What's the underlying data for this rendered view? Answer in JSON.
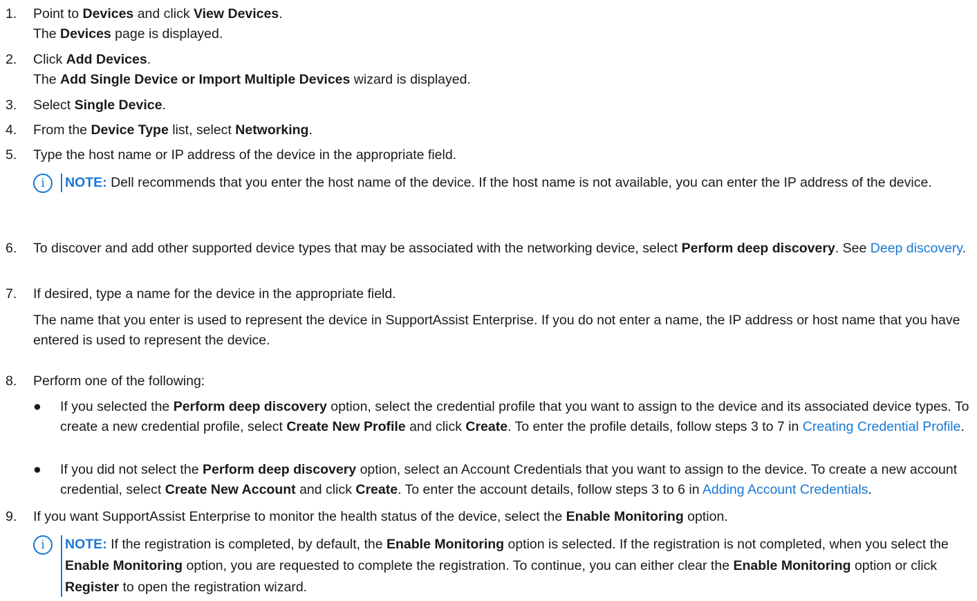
{
  "steps": [
    {
      "num": "1.",
      "l1a": "Point to ",
      "l1b": "Devices",
      "l1c": " and click ",
      "l1d": "View Devices",
      "l1e": ".",
      "l2a": "The ",
      "l2b": "Devices",
      "l2c": " page is displayed."
    },
    {
      "num": "2.",
      "l1a": "Click ",
      "l1b": "Add Devices",
      "l1c": ".",
      "l2a": "The ",
      "l2b": "Add Single Device or Import Multiple Devices",
      "l2c": " wizard is displayed."
    },
    {
      "num": "3.",
      "l1a": "Select ",
      "l1b": "Single Device",
      "l1c": "."
    },
    {
      "num": "4.",
      "l1a": "From the ",
      "l1b": "Device Type",
      "l1c": " list, select ",
      "l1d": "Networking",
      "l1e": "."
    },
    {
      "num": "5.",
      "l1a": "Type the host name or IP address of the device in the appropriate field."
    },
    {
      "num": "6.",
      "l1a": "To discover and add other supported device types that may be associated with the networking device, select ",
      "l1b": "Perform deep discovery",
      "l1c": ". See ",
      "link": "Deep discovery",
      "l1d": "."
    },
    {
      "num": "7.",
      "l1a": "If desired, type a name for the device in the appropriate field.",
      "para": "The name that you enter is used to represent the device in SupportAssist Enterprise. If you do not enter a name, the IP address or host name that you have entered is used to represent the device."
    },
    {
      "num": "8.",
      "l1a": "Perform one of the following:"
    },
    {
      "num": "9.",
      "l1a": "If you want SupportAssist Enterprise to monitor the health status of the device, select the ",
      "l1b": "Enable Monitoring",
      "l1c": " option."
    }
  ],
  "note1": {
    "icon": "info-icon",
    "label": "NOTE:",
    "text": " Dell recommends that you enter the host name of the device. If the host name is not available, you can enter the IP address of the device."
  },
  "bullets": [
    {
      "dot": "●",
      "a": "If you selected the ",
      "b": "Perform deep discovery",
      "c": " option, select the credential profile that you want to assign to the device and its associated device types. To create a new credential profile, select ",
      "d": "Create New Profile",
      "e": " and click ",
      "f": "Create",
      "g": ". To enter the profile details, follow steps 3 to 7 in ",
      "link": "Creating Credential Profile",
      "h": "."
    },
    {
      "dot": "●",
      "a": "If you did not select the ",
      "b": "Perform deep discovery",
      "c": " option, select an Account Credentials that you want to assign to the device. To create a new account credential, select ",
      "d": "Create New Account",
      "e": " and click ",
      "f": "Create",
      "g": ". To enter the account details, follow steps 3 to 6 in ",
      "link": "Adding Account Credentials",
      "h": "."
    }
  ],
  "note2": {
    "icon": "info-icon",
    "label": "NOTE:",
    "a": " If the registration is completed, by default, the ",
    "b": "Enable Monitoring",
    "c": " option is selected. If the registration is not completed, when you select the ",
    "d": "Enable Monitoring",
    "e": " option, you are requested to complete the registration. To continue, you can either clear the ",
    "f": "Enable Monitoring",
    "g": " option or click ",
    "h": "Register",
    "i": " to open the registration wizard."
  },
  "colors": {
    "accent": "#1978d4",
    "text": "#1a1a1a"
  }
}
